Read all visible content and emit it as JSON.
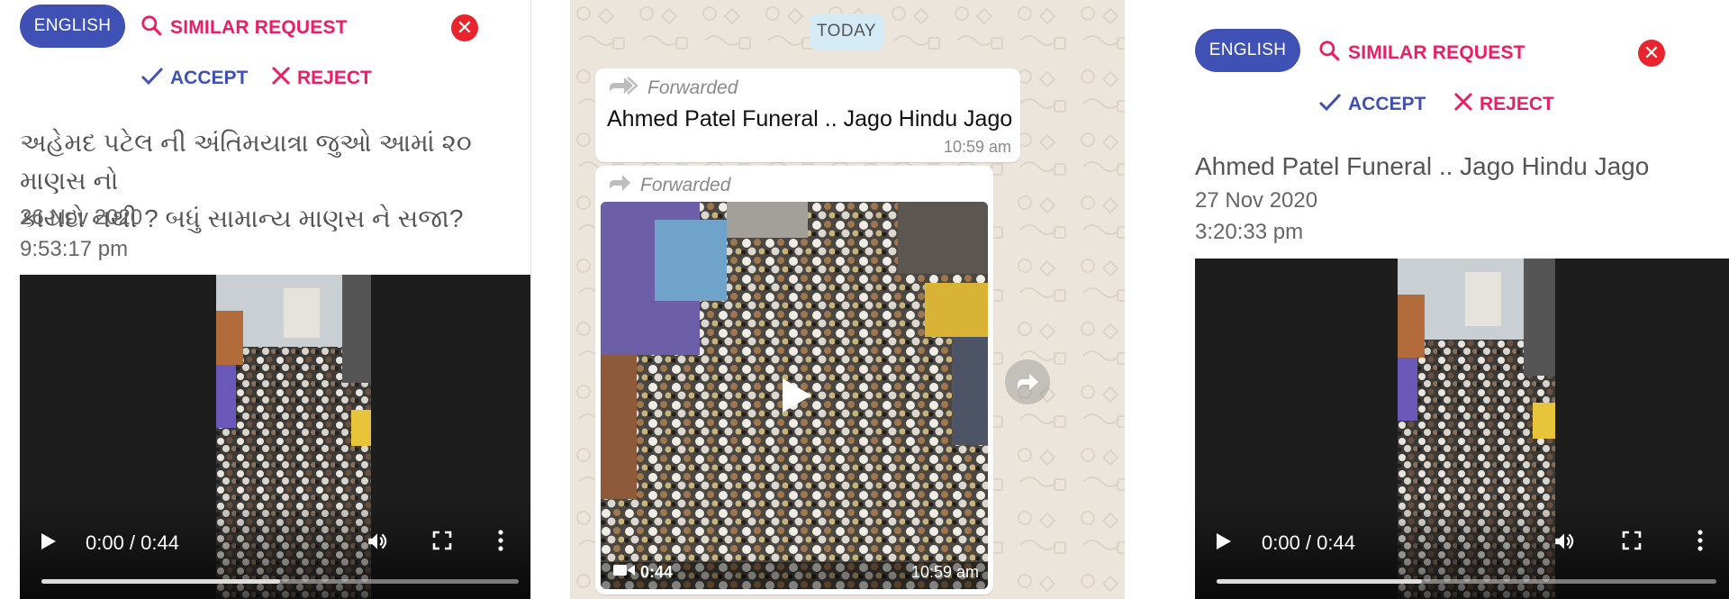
{
  "left": {
    "language_label": "ENGLISH",
    "similar_request_label": "SIMILAR REQUEST",
    "accept_label": "ACCEPT",
    "reject_label": "REJECT",
    "message_line1": "અહેમદ પટેલ ની અંતિમયાત્રા જુઓ આમાં ૨૦ માણસ નો",
    "message_line2": "કાયદો નથી ? બધું સામાન્ય માણસ ને સજા?",
    "date": "26 Nov 2020",
    "time": "9:53:17 pm",
    "video_time": "0:00 / 0:44",
    "video_progress": 0.5
  },
  "middle": {
    "today_label": "TODAY",
    "bubble1": {
      "forwarded_label": "Forwarded",
      "text": "Ahmed Patel Funeral .. Jago Hindu Jago",
      "time": "10:59 am"
    },
    "bubble2": {
      "forwarded_label": "Forwarded",
      "duration": "0:44",
      "time": "10:59 am"
    }
  },
  "right": {
    "language_label": "ENGLISH",
    "similar_request_label": "SIMILAR REQUEST",
    "accept_label": "ACCEPT",
    "reject_label": "REJECT",
    "message": "Ahmed Patel Funeral .. Jago Hindu Jago",
    "date": "27 Nov 2020",
    "time": "3:20:33 pm",
    "video_time": "0:00 / 0:44",
    "video_progress": 0.41
  },
  "colors": {
    "primary": "#3f51b5",
    "pink": "#e91e63",
    "close_red": "#e8242d",
    "whatsapp_bg": "#ece5dc"
  }
}
